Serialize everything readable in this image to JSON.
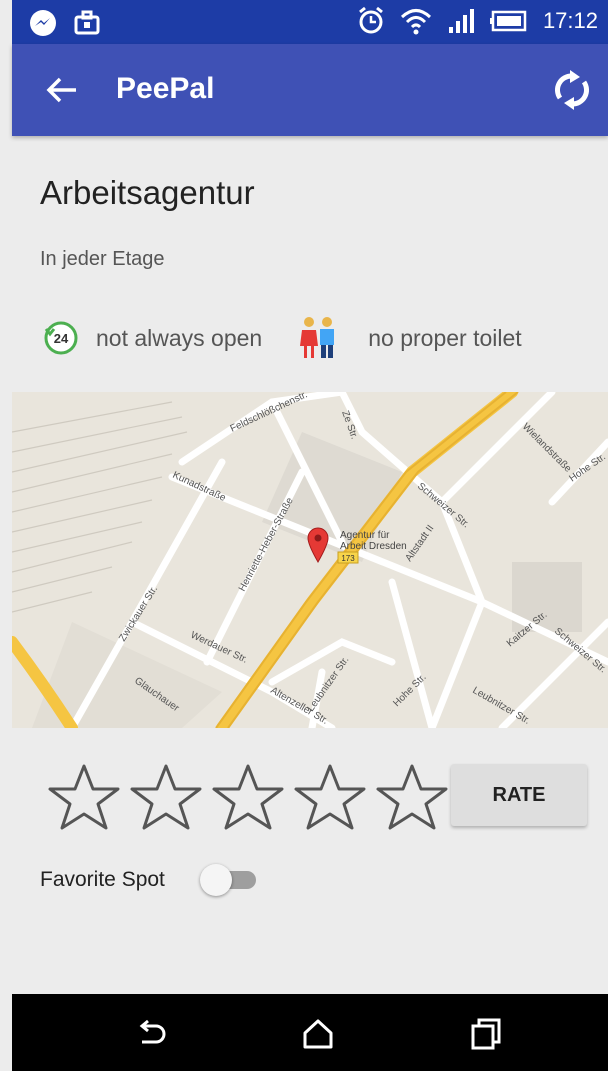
{
  "status_bar": {
    "time": "17:12",
    "icons": [
      "messenger-icon",
      "briefcase-icon",
      "alarm-icon",
      "wifi-icon",
      "signal-icon",
      "battery-icon"
    ]
  },
  "toolbar": {
    "title": "PeePal",
    "back_icon": "arrow-left-icon",
    "refresh_icon": "sync-icon",
    "background_color": "#3f51b5"
  },
  "place": {
    "name": "Arbeitsagentur",
    "description": "In jeder Etage",
    "opening": {
      "icon_text": "24",
      "label": "not always open"
    },
    "toilet": {
      "label": "no proper toilet"
    }
  },
  "map": {
    "marker_label_line1": "Agentur für",
    "marker_label_line2": "Arbeit Dresden",
    "road_badge": "173",
    "streets": [
      "Feldschlößchenstr.",
      "Ze Str.",
      "Wielandstraße",
      "Hohe Str.",
      "Kunadstraße",
      "Schweizer Str.",
      "Henriette-Heber-Straße",
      "Altstadt II",
      "Zwickauer Str.",
      "Werdauer Str.",
      "Kaitzer Str.",
      "Schweizer Str.",
      "Glauchauer",
      "Altenzeller Str.",
      "Leubnitzer Str.",
      "Hohe Str.",
      "Leubnitzer Str."
    ]
  },
  "rating": {
    "stars_total": 5,
    "stars_filled": 0,
    "button_label": "RATE"
  },
  "favorite": {
    "label": "Favorite Spot",
    "enabled": false
  },
  "nav_bar": {
    "icons": [
      "back-nav-icon",
      "home-nav-icon",
      "recents-nav-icon"
    ]
  }
}
